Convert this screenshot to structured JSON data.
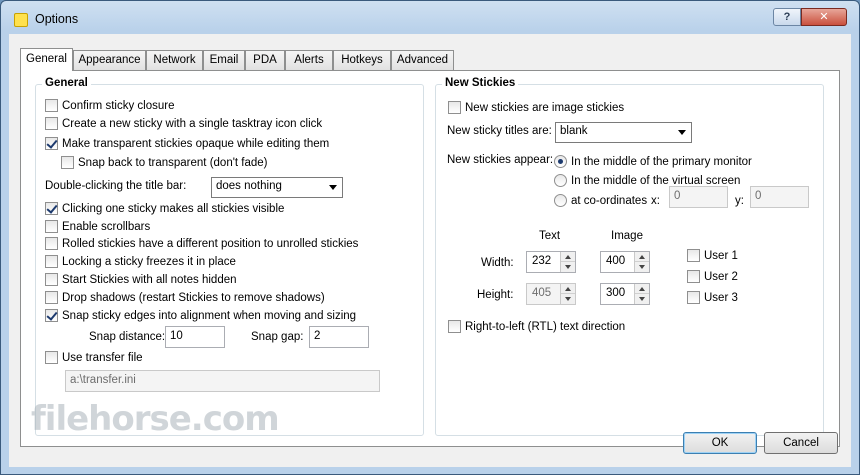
{
  "window": {
    "title": "Options",
    "help_label": "?",
    "close_label": "✕"
  },
  "tabs": [
    "General",
    "Appearance",
    "Network",
    "Email",
    "PDA",
    "Alerts",
    "Hotkeys",
    "Advanced"
  ],
  "general": {
    "title": "General",
    "options": [
      {
        "label": "Confirm sticky closure",
        "checked": false
      },
      {
        "label": "Create a new sticky with a single tasktray icon click",
        "checked": false
      },
      {
        "label": "Make transparent stickies opaque while editing them",
        "checked": true
      },
      {
        "label": "Snap back to transparent (don't fade)",
        "checked": false
      }
    ],
    "double_click_label": "Double-clicking the title bar:",
    "double_click_value": "does nothing",
    "options2": [
      {
        "label": "Clicking one sticky makes all stickies visible",
        "checked": true
      },
      {
        "label": "Enable scrollbars",
        "checked": false
      },
      {
        "label": "Rolled stickies have a different position to unrolled stickies",
        "checked": false
      },
      {
        "label": "Locking a sticky freezes it in place",
        "checked": false
      },
      {
        "label": "Start Stickies with all notes hidden",
        "checked": false
      },
      {
        "label": "Drop shadows (restart Stickies to remove shadows)",
        "checked": false
      },
      {
        "label": "Snap sticky edges into alignment when moving and sizing",
        "checked": true
      }
    ],
    "snap_distance_label": "Snap distance:",
    "snap_distance_value": "10",
    "snap_gap_label": "Snap gap:",
    "snap_gap_value": "2",
    "transfer_label": "Use transfer file",
    "transfer_checked": false,
    "transfer_path": "a:\\transfer.ini"
  },
  "new_stickies": {
    "title": "New Stickies",
    "image_label": "New stickies are image stickies",
    "image_checked": false,
    "titles_label": "New sticky titles are:",
    "titles_value": "blank",
    "appear_label": "New stickies appear:",
    "appear_options": [
      {
        "label": "In the middle of the primary monitor",
        "selected": true
      },
      {
        "label": "In the middle of the virtual screen",
        "selected": false
      },
      {
        "label": "at co-ordinates",
        "selected": false
      }
    ],
    "x_label": "x:",
    "x_value": "0",
    "y_label": "y:",
    "y_value": "0",
    "text_header": "Text",
    "image_header": "Image",
    "width_label": "Width:",
    "height_label": "Height:",
    "text_width": "232",
    "text_height": "405",
    "image_width": "400",
    "image_height": "300",
    "users": [
      {
        "label": "User 1",
        "checked": false
      },
      {
        "label": "User 2",
        "checked": false
      },
      {
        "label": "User 3",
        "checked": false
      }
    ],
    "rtl_label": "Right-to-left (RTL) text direction",
    "rtl_checked": false
  },
  "buttons": {
    "ok": "OK",
    "cancel": "Cancel"
  },
  "watermark": "filehorse.com"
}
